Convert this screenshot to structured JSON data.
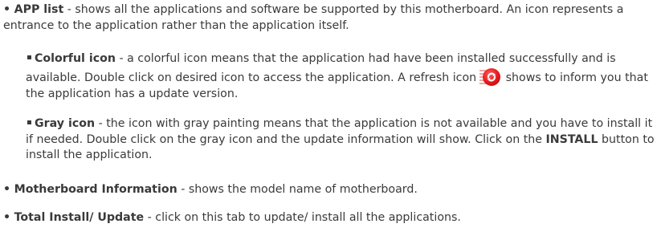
{
  "app_list": {
    "bullet": "•",
    "title": "APP list",
    "text": " - shows all the applications and software be supported by this motherboard. An icon represents a entrance to the application rather than the application itself."
  },
  "colorful_icon": {
    "title": "Colorful icon",
    "text_before_icon": " - a colorful icon means that the application had have been installed successfully and is available. Double click on desired icon to access the application. A refresh icon",
    "text_after_icon": " shows to inform you that the application has a update version.",
    "icon": "refresh-icon",
    "icon_color": "#e3161b"
  },
  "gray_icon": {
    "title": "Gray icon",
    "text_before_button": " - the icon with gray painting means that the application is not available and you have to install it if needed. Double click on the gray icon and the update information will show. Click on the ",
    "button_name": "INSTALL",
    "text_after_button": " button to install the application."
  },
  "motherboard_information": {
    "bullet": "•",
    "title": "Motherboard Information",
    "text": " - shows the model name of motherboard."
  },
  "total_install_update": {
    "bullet": "•",
    "title": "Total Install/ Update",
    "text": " - click on this tab to update/ install all the applications."
  }
}
